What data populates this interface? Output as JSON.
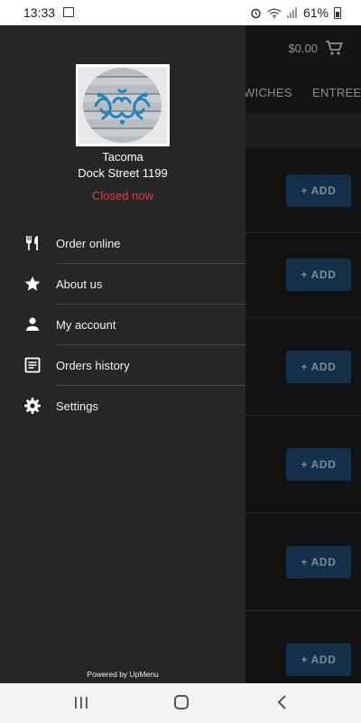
{
  "status_bar": {
    "time": "13:33",
    "battery": "61%"
  },
  "app": {
    "cart_total": "$0.00",
    "tabs": [
      "WICHES",
      "ENTREES"
    ],
    "add_button_label": "+ ADD"
  },
  "drawer": {
    "restaurant": {
      "name": "Tacoma",
      "address": "Dock Street 1199",
      "status": "Closed now"
    },
    "menu": [
      {
        "label": "Order online",
        "icon": "fork-knife-icon"
      },
      {
        "label": "About us",
        "icon": "star-icon"
      },
      {
        "label": "My account",
        "icon": "person-icon"
      },
      {
        "label": "Orders history",
        "icon": "receipt-icon"
      },
      {
        "label": "Settings",
        "icon": "gear-icon"
      }
    ],
    "powered_by": "Powered by UpMenu"
  },
  "colors": {
    "status_closed": "#e53935",
    "add_button": "#1e4a72",
    "drawer_bg": "#262626"
  }
}
